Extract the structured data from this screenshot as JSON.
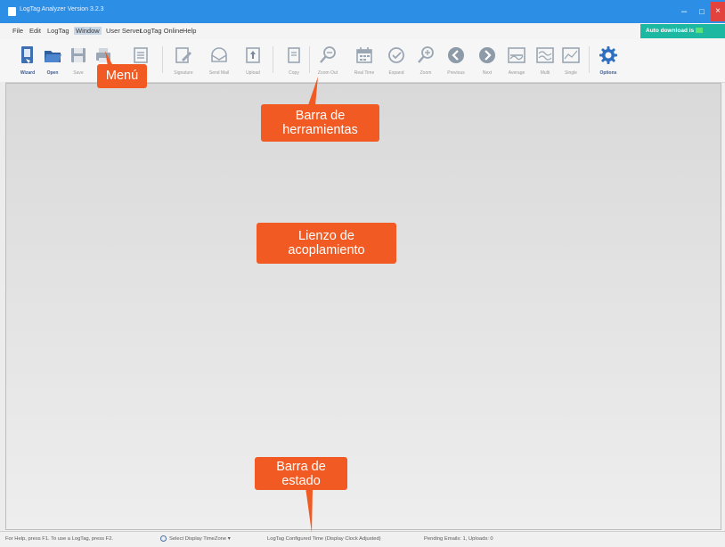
{
  "window": {
    "title": "LogTag Analyzer Version 3.2.3",
    "minimize_glyph": "–",
    "maximize_glyph": "□",
    "close_glyph": "×"
  },
  "menu": {
    "items": [
      "File",
      "Edit",
      "LogTag",
      "Window",
      "User Server",
      "LogTag Online",
      "Help"
    ],
    "active": "Window"
  },
  "auto_download": {
    "label": "Auto download is"
  },
  "toolbar": {
    "buttons": [
      {
        "label": "Wizard",
        "icon": "wizard-icon",
        "enabled": true
      },
      {
        "label": "Open",
        "icon": "open-folder-icon",
        "enabled": true
      },
      {
        "label": "Save",
        "icon": "save-icon",
        "enabled": false
      },
      {
        "label": "Print",
        "icon": "print-icon",
        "enabled": false
      },
      {
        "label": "Export",
        "icon": "export-icon",
        "enabled": false
      },
      {
        "label": "Signature",
        "icon": "signature-icon",
        "enabled": false
      },
      {
        "label": "Send Mail",
        "icon": "send-mail-icon",
        "enabled": false
      },
      {
        "label": "Upload",
        "icon": "upload-icon",
        "enabled": false
      },
      {
        "label": "Copy",
        "icon": "copy-icon",
        "enabled": false
      },
      {
        "label": "Zoom Out",
        "icon": "zoom-out-icon",
        "enabled": false
      },
      {
        "label": "Real Time",
        "icon": "calendar-icon",
        "enabled": false
      },
      {
        "label": "Expand",
        "icon": "check-circle-icon",
        "enabled": false
      },
      {
        "label": "Zoom",
        "icon": "zoom-in-icon",
        "enabled": false
      },
      {
        "label": "Previous",
        "icon": "previous-icon",
        "enabled": false
      },
      {
        "label": "Next",
        "icon": "next-icon",
        "enabled": false
      },
      {
        "label": "Average",
        "icon": "average-icon",
        "enabled": false
      },
      {
        "label": "Multi",
        "icon": "multi-icon",
        "enabled": false
      },
      {
        "label": "Single",
        "icon": "single-icon",
        "enabled": false
      },
      {
        "label": "Options",
        "icon": "gear-icon",
        "enabled": true
      }
    ]
  },
  "status": {
    "help": "For Help, press F1. To use a LogTag, press F2.",
    "timezone": "Select Display TimeZone",
    "timezone_arrow": "▾",
    "configured_time": "LogTag Configured Time (Display Clock Adjusted)",
    "pending": "Pending Emails: 1, Uploads: 0"
  },
  "callouts": {
    "menu": "Menú",
    "toolbar_line1": "Barra de",
    "toolbar_line2": "herramientas",
    "canvas_line1": "Lienzo de",
    "canvas_line2": "acoplamiento",
    "status_line1": "Barra de",
    "status_line2": "estado"
  },
  "colors": {
    "titlebar": "#2d8ee6",
    "callout": "#f15a22",
    "auto_download": "#1db8a2",
    "close_button": "#e3433f"
  }
}
